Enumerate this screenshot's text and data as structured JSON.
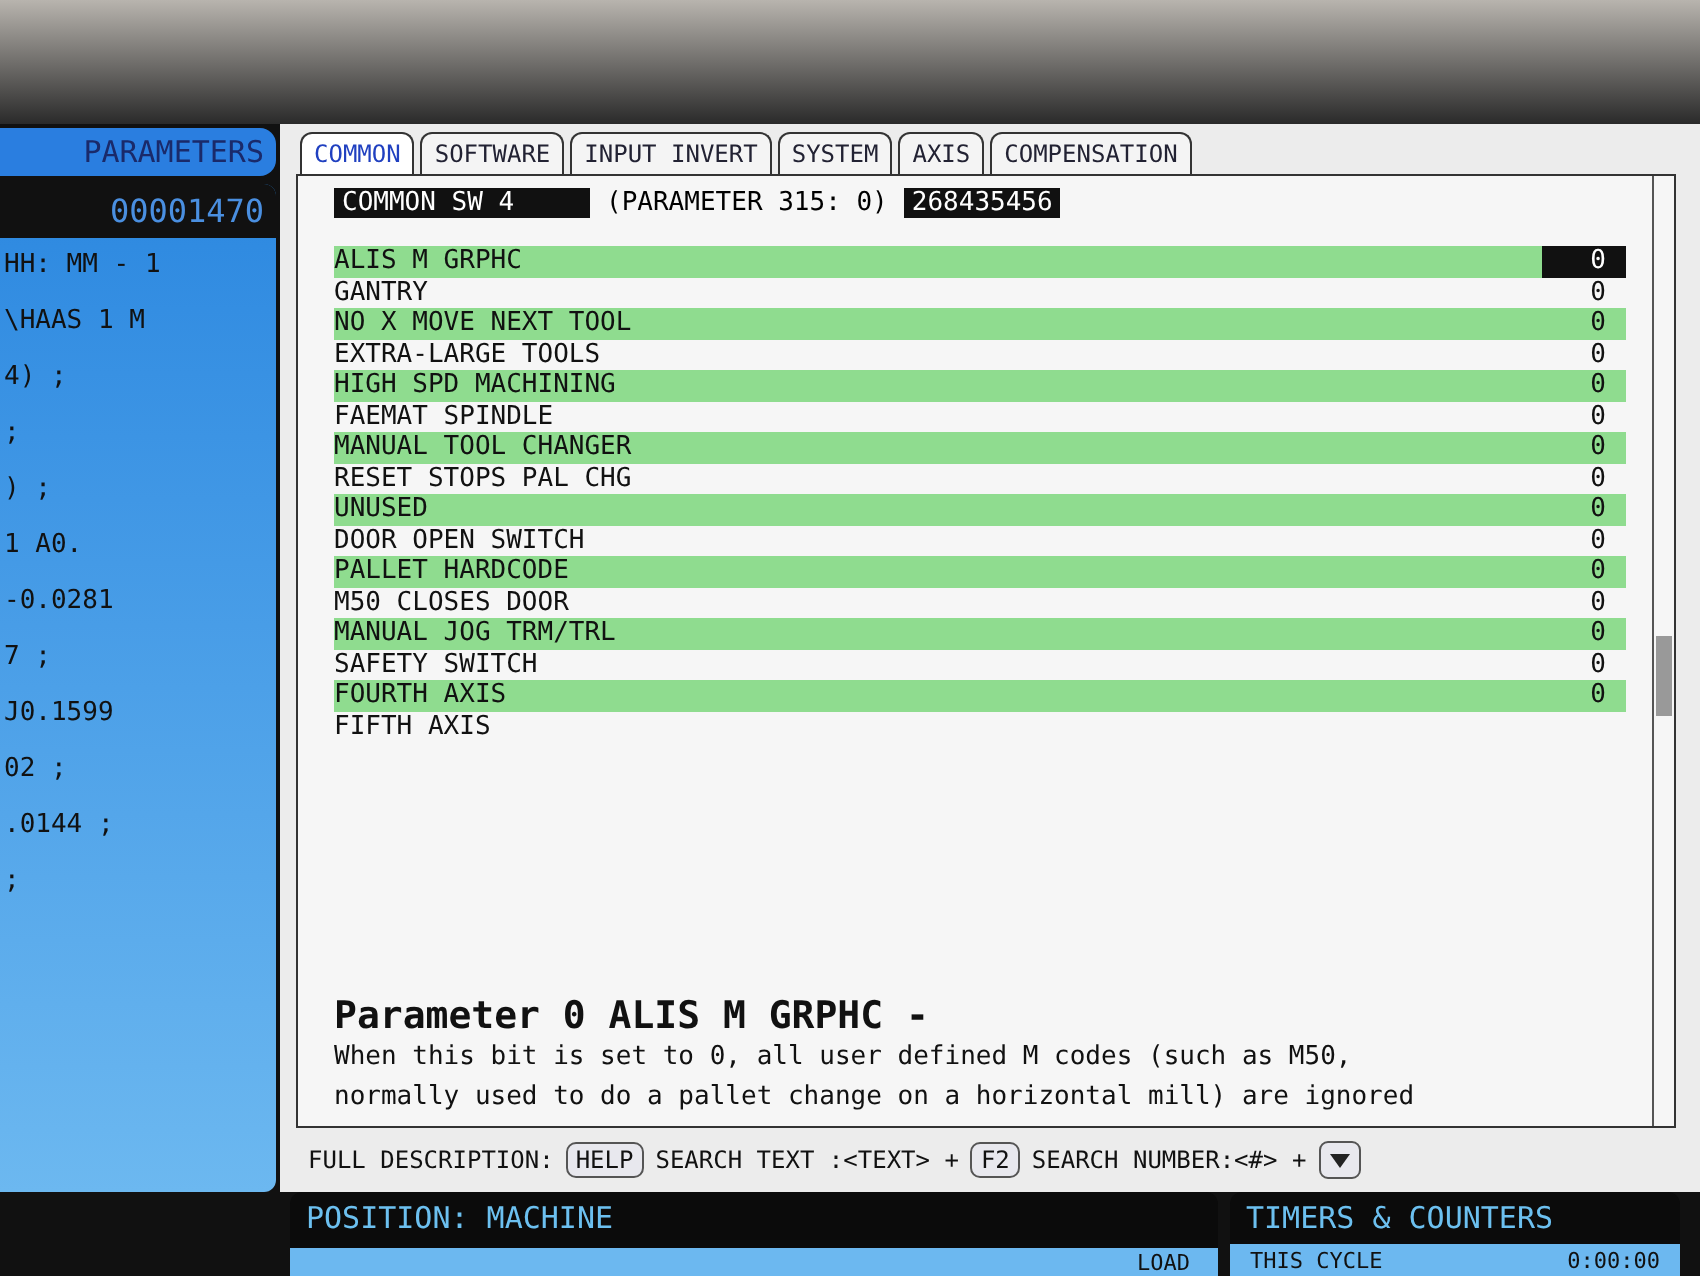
{
  "left_panel": {
    "title": "PARAMETERS",
    "program_number": "00001470",
    "lines": [
      "HH: MM - 1",
      "\\HAAS 1 M",
      "4) ;",
      ";",
      ") ;",
      "1 A0.",
      "-0.0281",
      "7 ;",
      "J0.1599",
      "02 ;",
      ".0144 ;",
      ";"
    ]
  },
  "tabs": [
    {
      "label": "COMMON",
      "selected": true
    },
    {
      "label": "SOFTWARE",
      "selected": false
    },
    {
      "label": "INPUT INVERT",
      "selected": false
    },
    {
      "label": "SYSTEM",
      "selected": false
    },
    {
      "label": "AXIS",
      "selected": false
    },
    {
      "label": "COMPENSATION",
      "selected": false
    }
  ],
  "parameter_header": {
    "name": "COMMON SW 4",
    "label": "(PARAMETER  315: 0)",
    "value": "268435456"
  },
  "bits": [
    {
      "name": "ALIS M GRPHC",
      "value": "0",
      "selected": true
    },
    {
      "name": "GANTRY",
      "value": "0",
      "selected": false
    },
    {
      "name": "NO X MOVE NEXT TOOL",
      "value": "0",
      "selected": false
    },
    {
      "name": "EXTRA-LARGE TOOLS",
      "value": "0",
      "selected": false
    },
    {
      "name": "HIGH SPD MACHINING",
      "value": "0",
      "selected": false
    },
    {
      "name": "FAEMAT SPINDLE",
      "value": "0",
      "selected": false
    },
    {
      "name": "MANUAL TOOL CHANGER",
      "value": "0",
      "selected": false
    },
    {
      "name": "RESET STOPS PAL CHG",
      "value": "0",
      "selected": false
    },
    {
      "name": "UNUSED",
      "value": "0",
      "selected": false
    },
    {
      "name": "DOOR OPEN SWITCH",
      "value": "0",
      "selected": false
    },
    {
      "name": "PALLET HARDCODE",
      "value": "0",
      "selected": false
    },
    {
      "name": "M50 CLOSES DOOR",
      "value": "0",
      "selected": false
    },
    {
      "name": "MANUAL JOG TRM/TRL",
      "value": "0",
      "selected": false
    },
    {
      "name": "SAFETY SWITCH",
      "value": "0",
      "selected": false
    },
    {
      "name": "FOURTH AXIS",
      "value": "0",
      "selected": false
    },
    {
      "name": "FIFTH  AXIS"
    }
  ],
  "description": {
    "title": "Parameter 0 ALIS M GRPHC -",
    "text_1": "When this bit is set to 0, all user defined M codes (such as M50,",
    "text_2": "normally used to do a pallet change on a horizontal mill) are ignored"
  },
  "help_bar": {
    "full_description": "FULL DESCRIPTION:",
    "help_key": "HELP",
    "search_text": "SEARCH TEXT :<TEXT> +",
    "f2_key": "F2",
    "search_number": "SEARCH NUMBER:<#> +"
  },
  "position_panel": {
    "title": "POSITION: MACHINE",
    "column": "LOAD"
  },
  "timers_panel": {
    "title": "TIMERS & COUNTERS",
    "label": "THIS CYCLE",
    "value": "0:00:00"
  }
}
